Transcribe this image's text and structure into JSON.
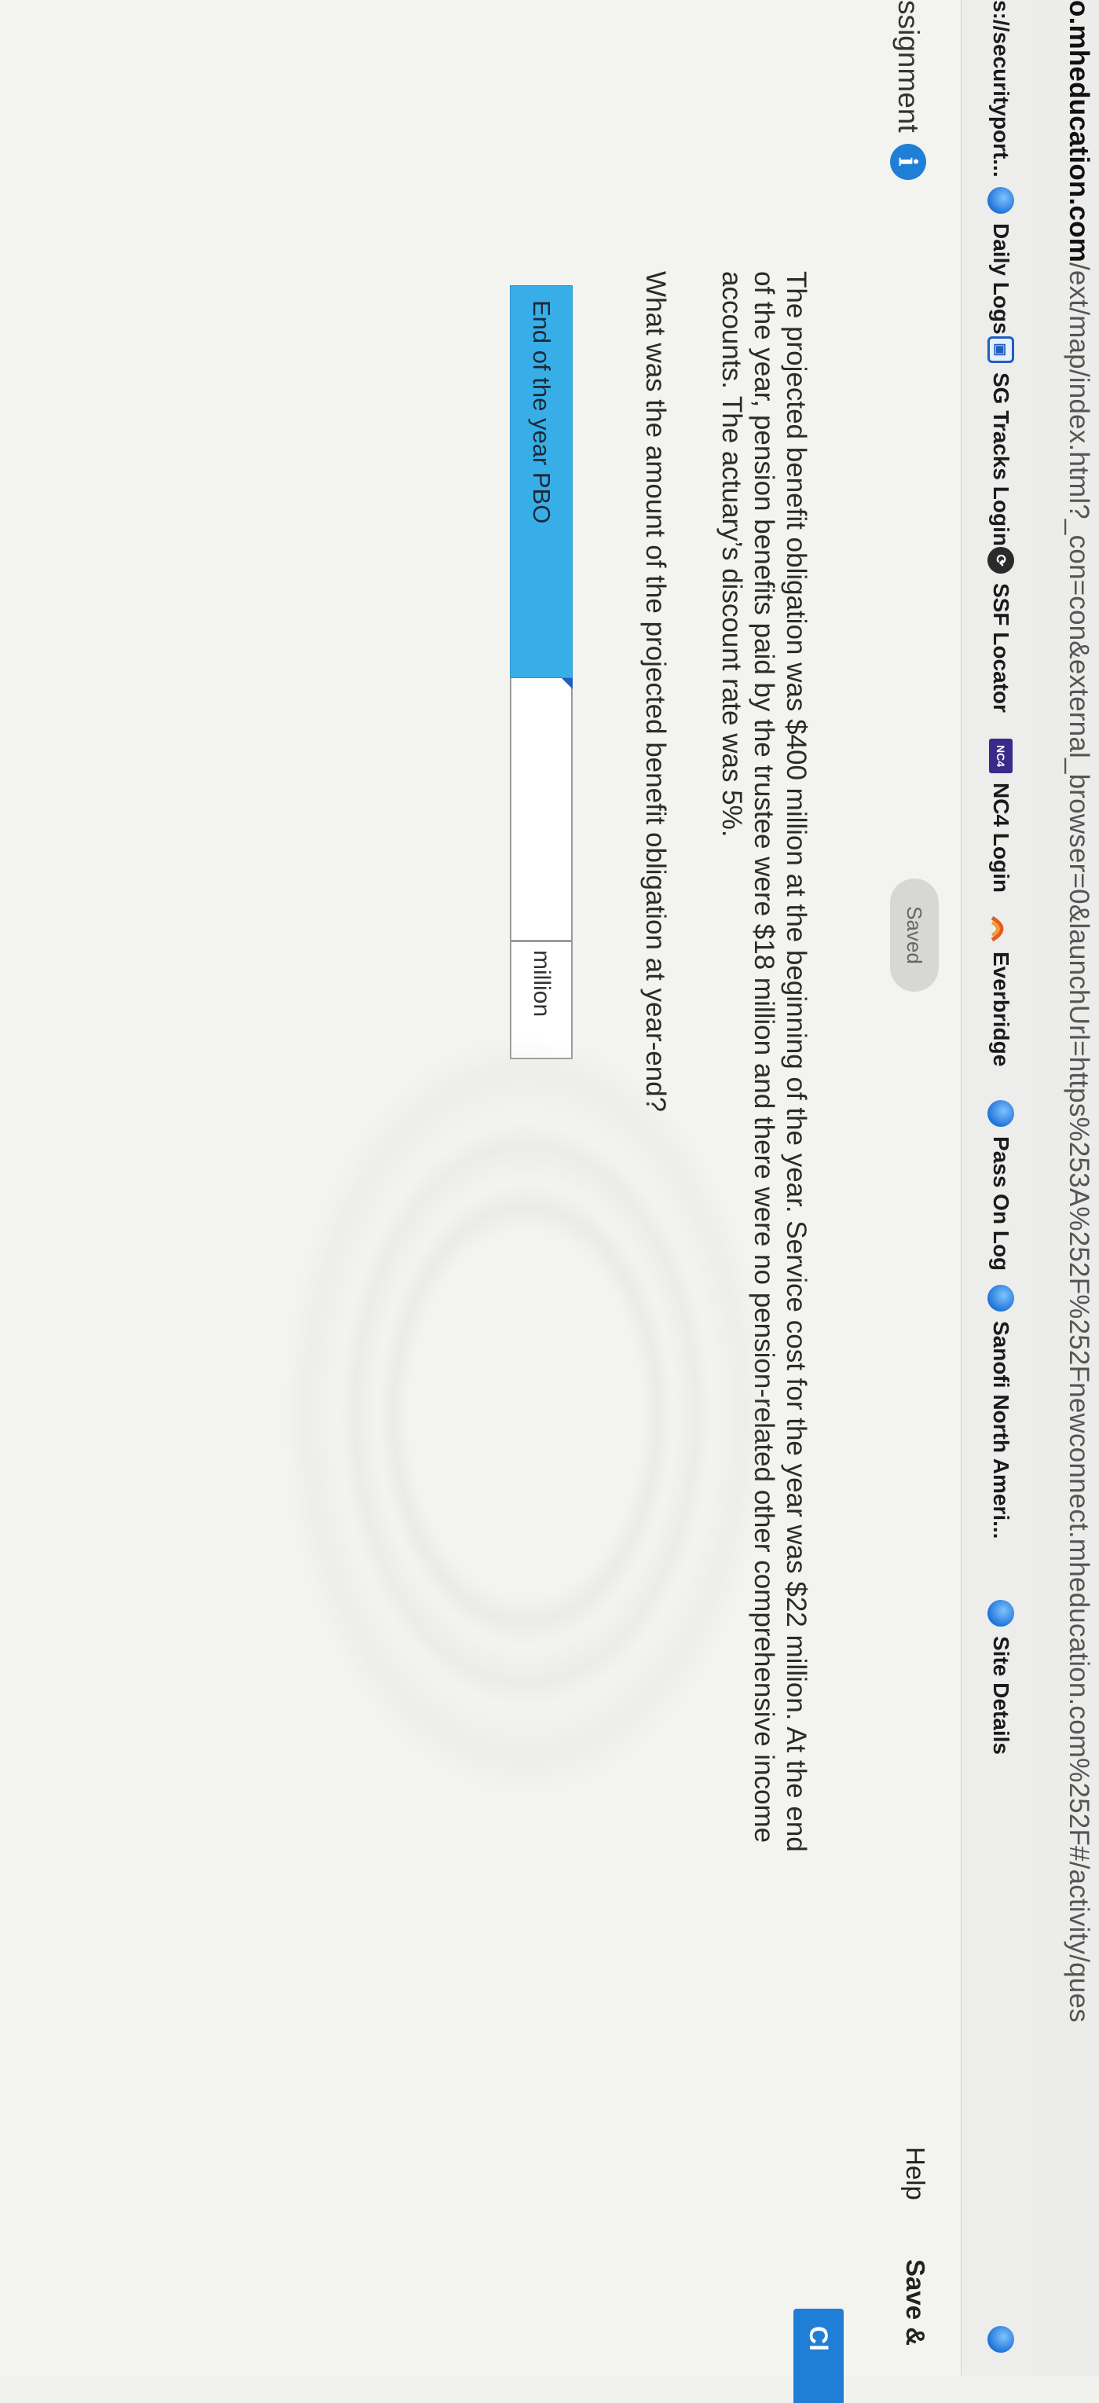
{
  "browser": {
    "url_prefix_bold": "o.mheducation.com",
    "url_rest": "/ext/map/index.html?_con=con&external_browser=0&launchUrl=https%253A%252F%252Fnewconnect.mheducation.com%252F#/activity/ques"
  },
  "bookmarks": [
    {
      "label": "s://securityport...",
      "icon": "none"
    },
    {
      "label": "Daily Logs",
      "icon": "globe-icon"
    },
    {
      "label": "SG Tracks Login",
      "icon": "sg-icon"
    },
    {
      "label": "SSF Locator",
      "icon": "ssf-icon"
    },
    {
      "label": "NC4 Login",
      "icon": "nc4-icon",
      "icon_text": "NC4"
    },
    {
      "label": "Everbridge",
      "icon": "everbridge-icon"
    },
    {
      "label": "Pass On Log",
      "icon": "globe-icon"
    },
    {
      "label": "Sanofi North Ameri...",
      "icon": "globe-icon"
    },
    {
      "label": "Site Details",
      "icon": "globe-icon"
    }
  ],
  "header": {
    "assignment_label": "ssignment",
    "info_glyph": "i",
    "saved_label": "Saved",
    "help_label": "Help",
    "save_exit_label": "Save &",
    "check_label": "Cl"
  },
  "question": {
    "text": "The projected benefit obligation was $400 million at the beginning of the year. Service cost for the year was $22 million. At the end of the year, pension benefits paid by the trustee were $18 million and there were no pension-related other comprehensive income accounts. The actuary’s discount rate was 5%.",
    "prompt": "What was the amount of the projected benefit obligation at year-end?"
  },
  "answer": {
    "label": "End of the year PBO",
    "value": "",
    "unit": "million"
  }
}
